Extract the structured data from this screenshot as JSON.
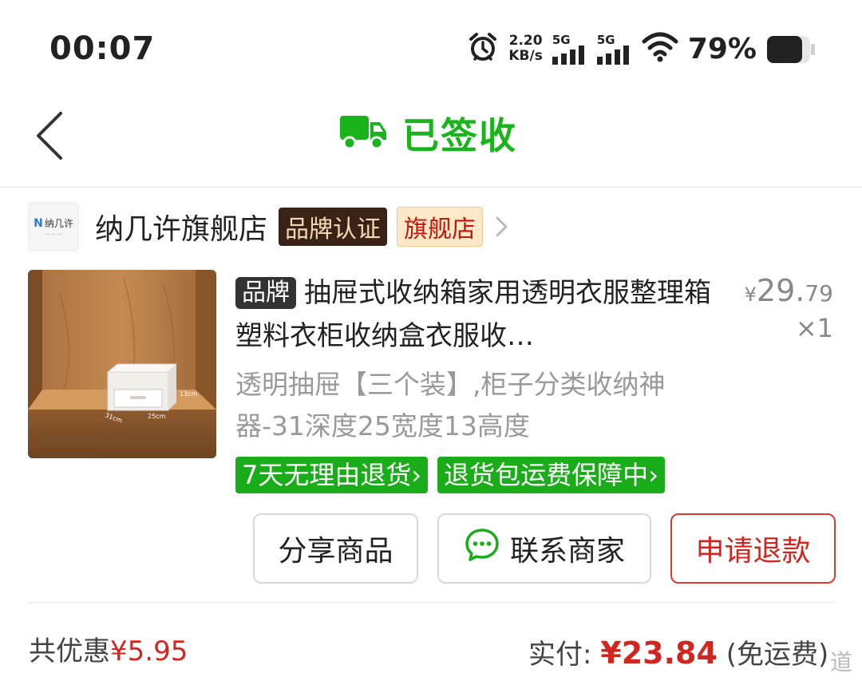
{
  "status_bar": {
    "time": "00:07",
    "net_speed_value": "2.20",
    "net_speed_unit": "KB/s",
    "signal_1_label": "5G",
    "signal_2_label": "5G",
    "battery_percent": "79%"
  },
  "header": {
    "title": "已签收",
    "accent_color": "#19b31c"
  },
  "shop": {
    "logo_text": "纳几许",
    "name": "纳几许旗舰店",
    "badge_brand": "品牌认证",
    "badge_flagship": "旗舰店"
  },
  "product": {
    "brand_tag": "品牌",
    "title": "抽屉式收纳箱家用透明衣服整理箱塑料衣柜收纳盒衣服收…",
    "price_symbol": "¥",
    "price_int": "29.",
    "price_dec": "79",
    "quantity": "×1",
    "spec": "透明抽屉【三个装】,柜子分类收纳神器-31深度25宽度13高度",
    "image_labels": {
      "height": "13cm",
      "depth": "31cm",
      "width": "25cm"
    },
    "service_tags": [
      "7天无理由退货",
      "退货包运费保障中"
    ]
  },
  "actions": {
    "share": "分享商品",
    "contact": "联系商家",
    "refund": "申请退款",
    "refund_color": "#d0261f"
  },
  "summary": {
    "discount_label": "共优惠",
    "discount_amount": "¥5.95",
    "paid_label": "实付:",
    "paid_amount": "¥23.84",
    "paid_note": "(免运费)"
  },
  "watermark": "道"
}
